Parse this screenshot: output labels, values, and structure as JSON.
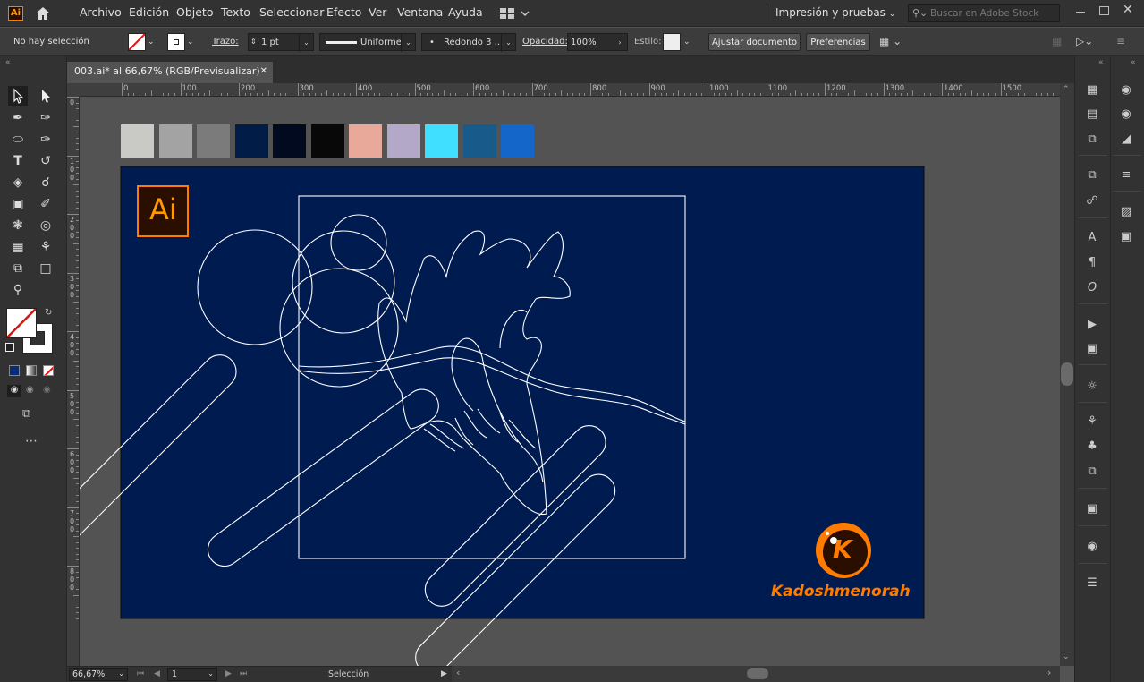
{
  "app": {
    "logo": "Ai"
  },
  "menu": [
    "Archivo",
    "Edición",
    "Objeto",
    "Texto",
    "Seleccionar",
    "Efecto",
    "Ver",
    "Ventana",
    "Ayuda"
  ],
  "workspace": "Impresión y pruebas",
  "search": {
    "placeholder": "Buscar en Adobe Stock"
  },
  "control": {
    "selection": "No hay selección",
    "stroke_label": "Trazo:",
    "stroke_value": "1 pt",
    "profile": "Uniforme",
    "brush": "Redondo 3 ...",
    "opacity_label": "Opacidad:",
    "opacity_value": "100%",
    "style_label": "Estilo:",
    "adjust_button": "Ajustar documento",
    "prefs_button": "Preferencias"
  },
  "tab": {
    "title": "003.ai* al 66,67% (RGB/Previsualizar)",
    "close": "✕"
  },
  "ruler_h": [
    "0",
    "100",
    "200",
    "300",
    "400",
    "500",
    "600",
    "700",
    "800",
    "900",
    "1000",
    "1100",
    "1200",
    "1300",
    "1400",
    "1500"
  ],
  "ruler_v": [
    "0",
    "100",
    "200",
    "300",
    "400",
    "500",
    "600",
    "700",
    "800"
  ],
  "swatches": [
    "#c9cac5",
    "#a3a3a3",
    "#7b7b7b",
    "#011c46",
    "#020a20",
    "#080808",
    "#e9a99a",
    "#b3a8c8",
    "#40deff",
    "#185b8a",
    "#1466c8"
  ],
  "colors": {
    "artboard": "#001b4f",
    "accent": "#ff7c00",
    "line": "#ffffff"
  },
  "artwork": {
    "ai_badge": "Ai",
    "brand_letter": "K",
    "brand_name": "Kadoshmenorah"
  },
  "status": {
    "zoom": "66,67%",
    "artboard_num": "1",
    "mode": "Selección"
  }
}
